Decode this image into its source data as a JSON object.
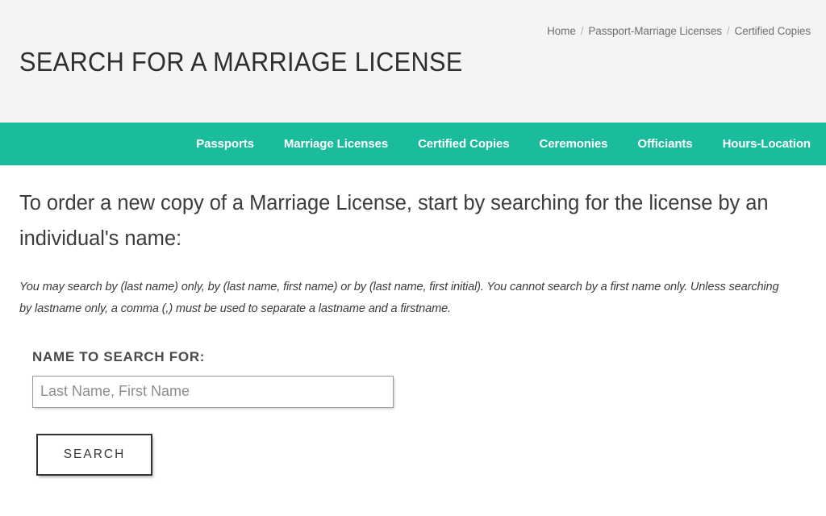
{
  "header": {
    "title": "SEARCH FOR A MARRIAGE LICENSE",
    "background_color": "#f4f4f4",
    "breadcrumb": {
      "separator": "/",
      "items": [
        {
          "label": "Home"
        },
        {
          "label": "Passport-Marriage Licenses"
        },
        {
          "label": "Certified Copies"
        }
      ]
    }
  },
  "nav": {
    "background_color": "#1abc9c",
    "text_color": "#ffffff",
    "items": [
      {
        "label": "Passports"
      },
      {
        "label": "Marriage Licenses"
      },
      {
        "label": "Certified Copies"
      },
      {
        "label": "Ceremonies"
      },
      {
        "label": "Officiants"
      },
      {
        "label": "Hours-Location"
      }
    ]
  },
  "main": {
    "lead_heading": "To order a new copy of a Marriage License, start by searching for the license by an individual's name:",
    "instructions": "You may search by (last name) only, by (last name, first name) or by (last name, first initial). You cannot search by a first name only. Unless searching by lastname only, a comma (,) must be used to separate a lastname and a firstname.",
    "form": {
      "label": "NAME TO SEARCH FOR:",
      "input_value": "",
      "input_placeholder": "Last Name, First Name",
      "submit_label": "SEARCH"
    }
  }
}
